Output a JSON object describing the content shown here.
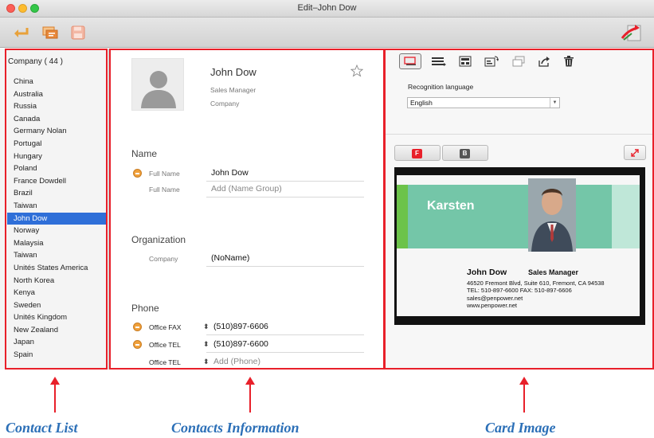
{
  "window": {
    "title": "Edit–John Dow"
  },
  "contact_list": {
    "header": "Company ( 44 )",
    "items": [
      {
        "label": "China"
      },
      {
        "label": "Australia"
      },
      {
        "label": "Russia"
      },
      {
        "label": "Canada"
      },
      {
        "label": "Germany Nolan"
      },
      {
        "label": "Portugal"
      },
      {
        "label": "Hungary"
      },
      {
        "label": "Poland"
      },
      {
        "label": "France Dowdell"
      },
      {
        "label": "Brazil"
      },
      {
        "label": "Taiwan"
      },
      {
        "label": "John Dow",
        "selected": true
      },
      {
        "label": "Norway"
      },
      {
        "label": "Malaysia"
      },
      {
        "label": "Taiwan"
      },
      {
        "label": "Unités States America"
      },
      {
        "label": "North Korea"
      },
      {
        "label": "Kenya"
      },
      {
        "label": "Sweden"
      },
      {
        "label": "Unités Kingdom"
      },
      {
        "label": "New Zealand"
      },
      {
        "label": "Japan"
      },
      {
        "label": "Spain"
      }
    ]
  },
  "contact": {
    "name": "John Dow",
    "title": "Sales Manager",
    "company_placeholder": "Company",
    "sections": {
      "name": "Name",
      "organization": "Organization",
      "phone": "Phone"
    },
    "name_rows": [
      {
        "label": "Full Name",
        "value": "John Dow"
      },
      {
        "label": "Full Name",
        "value": "Add (Name Group)"
      }
    ],
    "org_rows": [
      {
        "label": "Company",
        "value": "(NoName)"
      }
    ],
    "phone_rows": [
      {
        "label": "Office FAX",
        "value": "(510)897-6606"
      },
      {
        "label": "Office TEL",
        "value": "(510)897-6600"
      },
      {
        "label": "Office TEL",
        "value": "Add (Phone)"
      }
    ]
  },
  "card_panel": {
    "recognition_label": "Recognition language",
    "language": "English",
    "front_label": "F",
    "back_label": "B",
    "card": {
      "brand": "Karsten",
      "name": "John Dow",
      "title": "Sales Manager",
      "address": "46520 Fremont Blvd, Suite 610, Fremont, CA 94538",
      "phones": "TEL: 510-897-6600     FAX: 510-897-6606",
      "email": "sales@penpower.net",
      "web": "www.penpower.net"
    }
  },
  "callouts": {
    "left": "Contact List",
    "middle": "Contacts Information",
    "right": "Card Image"
  },
  "colors": {
    "accent_red": "#e8202a",
    "selection_blue": "#2f6fd8",
    "callout_blue": "#2b6fb7"
  }
}
